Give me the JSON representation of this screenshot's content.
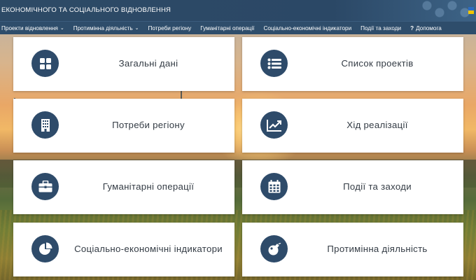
{
  "header": {
    "title": "ЕКОНОМІЧНОГО ТА СОЦІАЛЬНОГО ВІДНОВЛЕННЯ",
    "flag_colors": [
      "#2d6cc0",
      "#f2c500"
    ]
  },
  "nav": {
    "items": [
      {
        "label": "Проекти відновлення",
        "dropdown": true
      },
      {
        "label": "Протимінна діяльність",
        "dropdown": true
      },
      {
        "label": "Потреби регіону",
        "dropdown": false
      },
      {
        "label": "Гуманітарні операції",
        "dropdown": false
      },
      {
        "label": "Соціально-економічні індикатори",
        "dropdown": false
      },
      {
        "label": "Події та заходи",
        "dropdown": false
      },
      {
        "label": "Допомога",
        "dropdown": false
      }
    ],
    "help_glyph": "?"
  },
  "cards": [
    {
      "label": "Загальні дані",
      "icon": "grid-icon"
    },
    {
      "label": "Список проектів",
      "icon": "list-icon"
    },
    {
      "label": "Потреби регіону",
      "icon": "building-icon"
    },
    {
      "label": "Хід реалізації",
      "icon": "trend-chart-icon"
    },
    {
      "label": "Гуманітарні операції",
      "icon": "briefcase-icon"
    },
    {
      "label": "Події та заходи",
      "icon": "calendar-icon"
    },
    {
      "label": "Соціально-економічні індикатори",
      "icon": "pie-chart-icon"
    },
    {
      "label": "Протимінна діяльність",
      "icon": "bomb-icon"
    }
  ],
  "colors": {
    "header_bg": "#2d4a66",
    "icon_circle": "#2e4b6a",
    "card_bg": "#ffffff",
    "card_text": "#333b44"
  }
}
